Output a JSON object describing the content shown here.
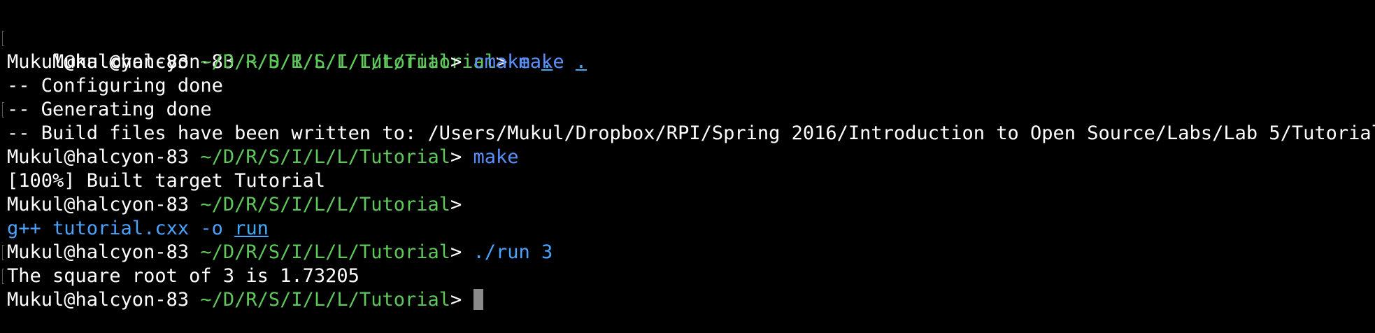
{
  "terminal": {
    "prompt_user": "Mukul@halcyon-83",
    "prompt_path": "~/D/R/S/I/L/L/Tutorial",
    "prompt_symbol": ">",
    "lines": {
      "l1_cmd": "make",
      "l1_arg": ".",
      "l2_cmd": "cmake",
      "l2_arg": ".",
      "l3_out": "-- Configuring done",
      "l4_out": "-- Generating done",
      "l5_out": "-- Build files have been written to: /Users/Mukul/Dropbox/RPI/Spring 2016/Introduction to Open Source/Labs/Lab 5/Tutorial",
      "l6_cmd": "make",
      "l7_out": "[100%] Built target Tutorial",
      "l9_cmd": "g++ tutorial.cxx -o",
      "l9_arg": "run",
      "l10_cmd": "./run 3",
      "l11_out": "The square root of 3 is 1.73205"
    }
  },
  "colors": {
    "background": "#000000",
    "text": "#ffffff",
    "path": "#5fc85b",
    "command": "#5b8fff",
    "link": "#3fa9f5",
    "cursor": "#8a8a8a"
  }
}
